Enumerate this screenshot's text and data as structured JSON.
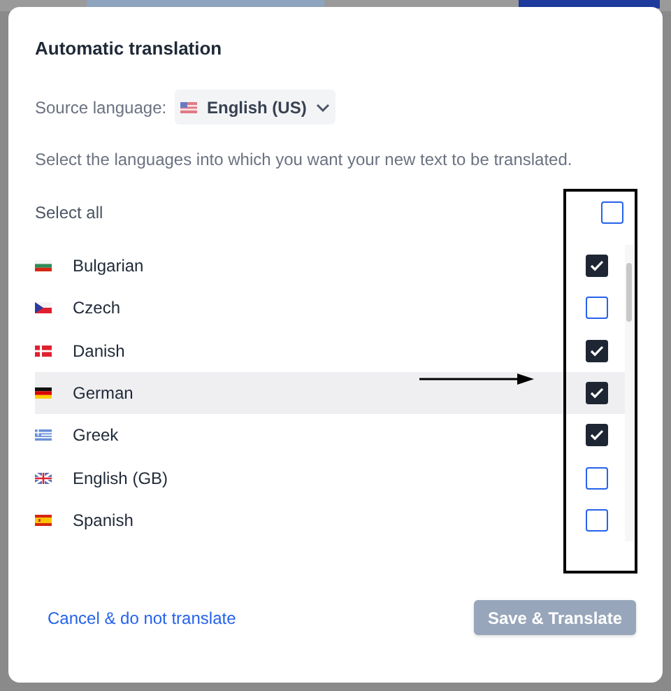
{
  "dialog": {
    "title": "Automatic translation",
    "source": {
      "label": "Source language:",
      "value": "English (US)",
      "kind": "us"
    },
    "instruction": "Select the languages into which you want your new text to be translated.",
    "select_all": {
      "label": "Select all",
      "checked": false
    },
    "languages": [
      {
        "name": "Bulgarian",
        "kind": "bg",
        "checked": true,
        "highlighted": false
      },
      {
        "name": "Czech",
        "kind": "cz",
        "checked": false,
        "highlighted": false
      },
      {
        "name": "Danish",
        "kind": "dk",
        "checked": true,
        "highlighted": false
      },
      {
        "name": "German",
        "kind": "de",
        "checked": true,
        "highlighted": true
      },
      {
        "name": "Greek",
        "kind": "gr",
        "checked": true,
        "highlighted": false
      },
      {
        "name": "English (GB)",
        "kind": "gb",
        "checked": false,
        "highlighted": false
      },
      {
        "name": "Spanish",
        "kind": "es",
        "checked": false,
        "highlighted": false
      }
    ],
    "cancel": "Cancel & do not translate",
    "save": {
      "label": "Save & Translate",
      "disabled": true
    }
  }
}
